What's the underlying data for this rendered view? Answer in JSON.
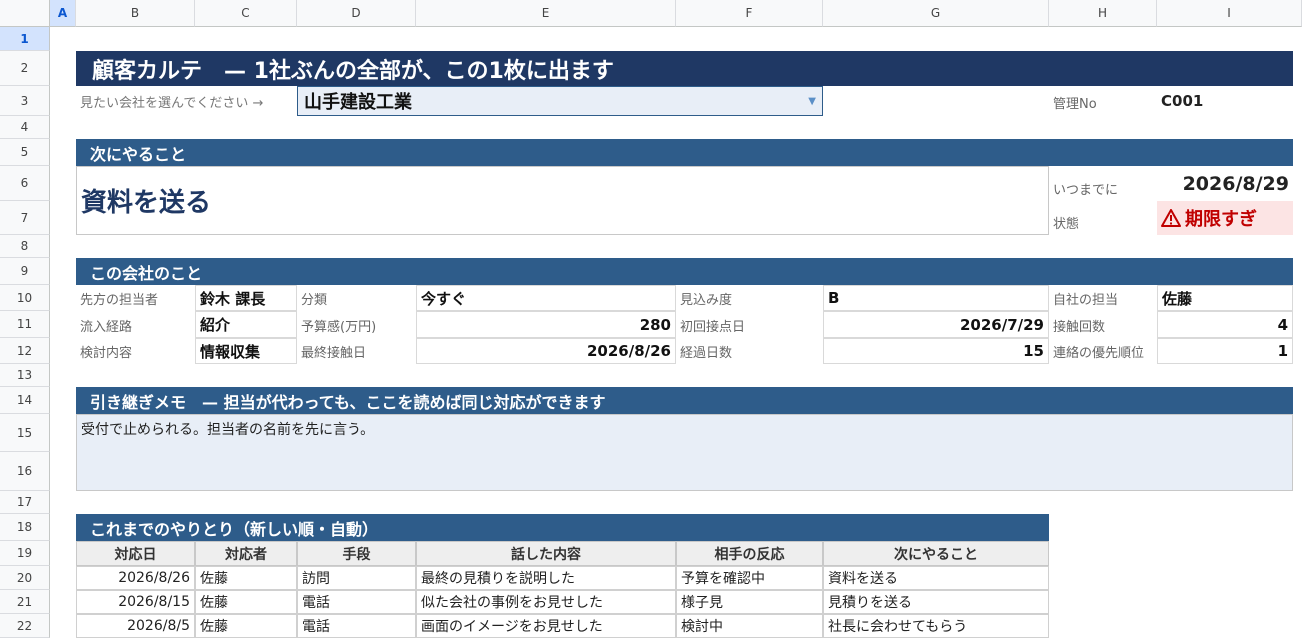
{
  "sheet": {
    "columns": [
      "A",
      "B",
      "C",
      "D",
      "E",
      "F",
      "G",
      "H",
      "I"
    ],
    "rows": [
      "1",
      "2",
      "3",
      "4",
      "5",
      "6",
      "7",
      "8",
      "9",
      "10",
      "11",
      "12",
      "13",
      "14",
      "15",
      "16",
      "17",
      "18",
      "19",
      "20",
      "21",
      "22"
    ]
  },
  "title": "顧客カルテ　— 1社ぶんの全部が、この1枚に出ます",
  "selector": {
    "label": "見たい会社を選んでください →",
    "value": "山手建設工業"
  },
  "mgmt": {
    "label": "管理No",
    "value": "C001"
  },
  "next": {
    "header": "次にやること",
    "action": "資料を送る",
    "due_label": "いつまでに",
    "due_value": "2026/8/29",
    "status_label": "状態",
    "status_value": "期限すぎ"
  },
  "company": {
    "header": "この会社のこと",
    "contact_label": "先方の担当者",
    "contact_value": "鈴木 課長",
    "channel_label": "流入経路",
    "channel_value": "紹介",
    "topic_label": "検討内容",
    "topic_value": "情報収集",
    "class_label": "分類",
    "class_value": "今すぐ",
    "budget_label": "予算感(万円)",
    "budget_value": "280",
    "last_label": "最終接触日",
    "last_value": "2026/8/26",
    "prospect_label": "見込み度",
    "prospect_value": "B",
    "first_label": "初回接点日",
    "first_value": "2026/7/29",
    "elapsed_label": "経過日数",
    "elapsed_value": "15",
    "owner_label": "自社の担当",
    "owner_value": "佐藤",
    "count_label": "接触回数",
    "count_value": "4",
    "priority_label": "連絡の優先順位",
    "priority_value": "1"
  },
  "memo": {
    "header": "引き継ぎメモ　— 担当が代わっても、ここを読めば同じ対応ができます",
    "text": "受付で止められる。担当者の名前を先に言う。"
  },
  "history": {
    "header": "これまでのやりとり（新しい順・自動）",
    "columns": [
      "対応日",
      "対応者",
      "手段",
      "話した内容",
      "相手の反応",
      "次にやること"
    ],
    "rows": [
      [
        "2026/8/26",
        "佐藤",
        "訪問",
        "最終の見積りを説明した",
        "予算を確認中",
        "資料を送る"
      ],
      [
        "2026/8/15",
        "佐藤",
        "電話",
        "似た会社の事例をお見せした",
        "様子見",
        "見積りを送る"
      ],
      [
        "2026/8/5",
        "佐藤",
        "電話",
        "画面のイメージをお見せした",
        "検討中",
        "社長に会わせてもらう"
      ]
    ]
  },
  "colors": {
    "title_band": "#1f3864",
    "section_band": "#2e5c8a",
    "alert_bg": "#fce4e4",
    "alert_text": "#c00000",
    "memo_bg": "#e8eef7"
  }
}
